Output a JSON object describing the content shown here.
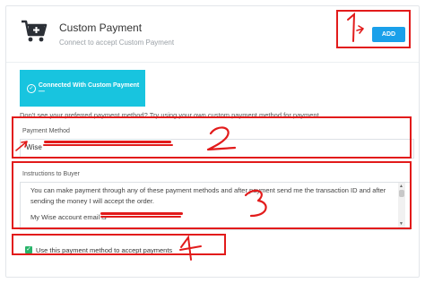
{
  "header": {
    "title": "Custom Payment",
    "subtitle": "Connect to accept Custom Payment",
    "add_label": "ADD"
  },
  "connected_button_label": "Connected With Custom Payment —",
  "hint_text": "Don't see your preferred payment method? Try using your own custom payment method for payment.",
  "payment_method": {
    "label": "Payment Method",
    "value_prefix": "Wise"
  },
  "instructions": {
    "label": "Instructions to Buyer",
    "line1": "You can make payment through any of these payment methods and after payment send me the transaction ID and after",
    "line2": "sending the money I will accept the order.",
    "line3": "My Wise account email is"
  },
  "checkbox": {
    "label": "Use this payment method to accept payments",
    "checked": true
  },
  "annotations": {
    "colour": "#e21b1b",
    "numbers": [
      "1",
      "2",
      "3",
      "4"
    ]
  }
}
